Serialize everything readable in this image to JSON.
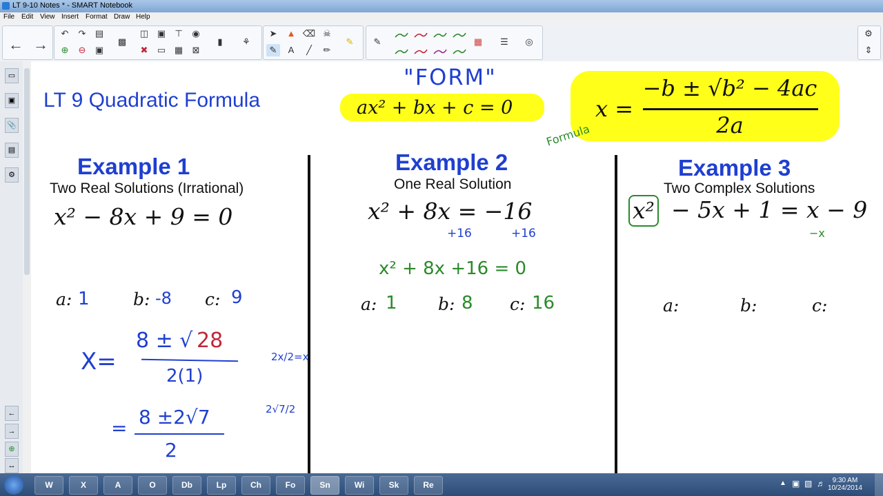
{
  "window": {
    "title": "LT 9-10 Notes * - SMART Notebook"
  },
  "menu": [
    "File",
    "Edit",
    "View",
    "Insert",
    "Format",
    "Draw",
    "Help"
  ],
  "toolbar": {
    "icons": [
      "back-icon",
      "forward-icon",
      "undo-icon",
      "redo-icon",
      "paste-icon",
      "delete-icon",
      "screen-shade-icon",
      "table-icon",
      "select-icon",
      "pen-icon",
      "eraser-icon",
      "fill-icon",
      "text-icon",
      "line-icon",
      "shape-icon",
      "magic-pen-icon",
      "color-palette-icon",
      "line-style-icon",
      "properties-icon"
    ],
    "pen_colors": [
      "#2a8a2a",
      "#c0283a",
      "#2a8a2a",
      "#2a8a2a",
      "#2a8a2a",
      "#a02a8a",
      "#2a8a2a"
    ]
  },
  "page": {
    "title": "LT 9 Quadratic Formula",
    "form_label": "\"FORM\"",
    "form_equation": "ax² + bx + c = 0",
    "formula_label": "Formula",
    "formula": {
      "lhs": "x =",
      "numerator": "−b ± √b² − 4ac",
      "denominator": "2a"
    },
    "examples": [
      {
        "heading": "Example 1",
        "subheading": "Two Real Solutions (Irrational)",
        "equation": "x² − 8x + 9 = 0",
        "a_label": "a:",
        "a_val": "1",
        "b_label": "b:",
        "b_val": "-8",
        "c_label": "c:",
        "c_val": "9",
        "work": {
          "x_eq": "X=",
          "num1_prefix": "8 ± √",
          "num1_rad": "28",
          "den1": "2(1)",
          "side1": "2x/2=x",
          "eq2": "=",
          "num2": "8 ±2√7",
          "den2": "2",
          "side2": "2√7/2"
        }
      },
      {
        "heading": "Example 2",
        "subheading": "One Real Solution",
        "equation": "x² + 8x = −16",
        "add_left": "+16",
        "add_right": "+16",
        "rewritten": "x² + 8x +16 = 0",
        "a_label": "a:",
        "a_val": "1",
        "b_label": "b:",
        "b_val": "8",
        "c_label": "c:",
        "c_val": "16"
      },
      {
        "heading": "Example 3",
        "subheading": "Two Complex Solutions",
        "equation_boxed": "x²",
        "equation_rest": "− 5x + 1 = x − 9",
        "sub_note": "−x",
        "a_label": "a:",
        "b_label": "b:",
        "c_label": "c:"
      }
    ]
  },
  "taskbar": {
    "apps": [
      "W",
      "X",
      "A",
      "O",
      "Db",
      "Lp",
      "Ch",
      "Fo",
      "Sn",
      "Wi",
      "Sk",
      "Re"
    ],
    "time": "9:30 AM",
    "date": "10/24/2014"
  }
}
